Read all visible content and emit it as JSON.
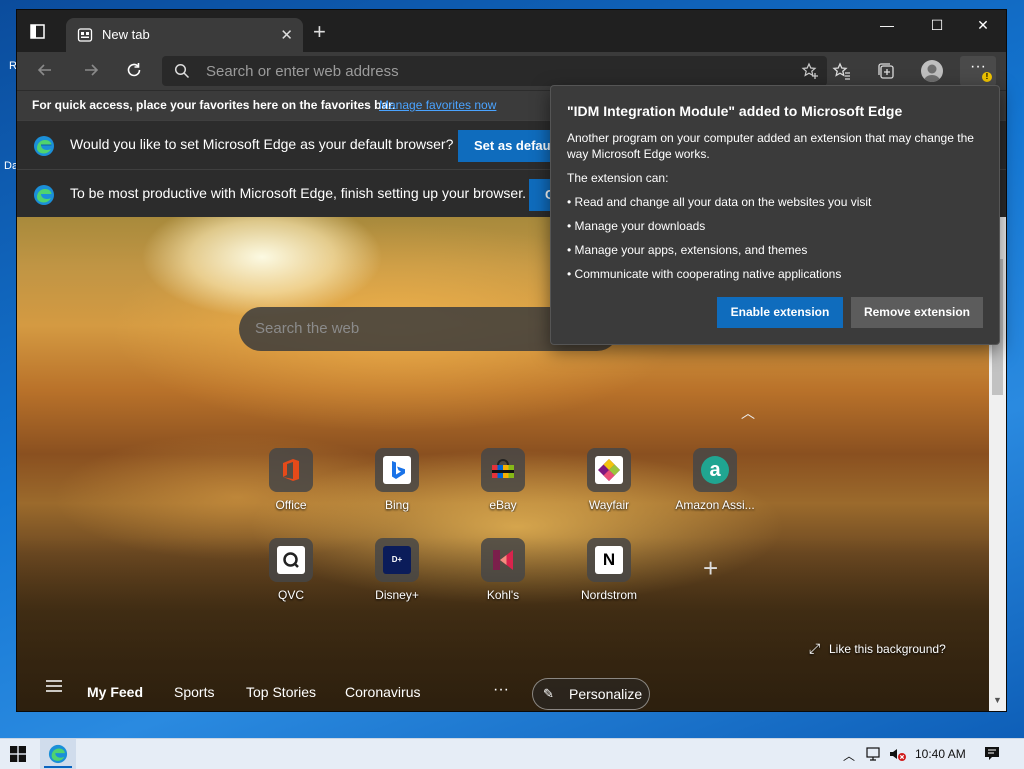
{
  "desktop": {
    "label_1": "R",
    "label_2": "Da"
  },
  "tab": {
    "title": "New tab",
    "close": "✕"
  },
  "window_controls": {
    "minimize": "—",
    "maximize": "☐",
    "close": "✕"
  },
  "new_tab": "+",
  "toolbar": {
    "address_placeholder": "Search or enter web address",
    "more": "···"
  },
  "favorites_bar": {
    "text": "For quick access, place your favorites here on the favorites bar.",
    "link": "Manage favorites now"
  },
  "infobars": [
    {
      "text": "Would you like to set Microsoft Edge as your default browser?",
      "button": "Set as default"
    },
    {
      "text": "To be most productive with Microsoft Edge, finish setting up your browser.",
      "button": "C"
    }
  ],
  "popup": {
    "title": "\"IDM Integration Module\" added to Microsoft Edge",
    "description": "Another program on your computer added an extension that may change the way Microsoft Edge works.",
    "can_label": "The extension can:",
    "permissions": [
      "• Read and change all your data on the websites you visit",
      "• Manage your downloads",
      "• Manage your apps, extensions, and themes",
      "• Communicate with cooperating native applications"
    ],
    "enable_button": "Enable extension",
    "remove_button": "Remove extension",
    "colors": {
      "primary": "#0f6cbd",
      "secondary": "#5c5c5c"
    }
  },
  "page": {
    "search_placeholder": "Search the web",
    "tiles": [
      {
        "label": "Office",
        "icon": "office-icon"
      },
      {
        "label": "Bing",
        "icon": "bing-icon"
      },
      {
        "label": "eBay",
        "icon": "ebay-icon"
      },
      {
        "label": "Wayfair",
        "icon": "wayfair-icon"
      },
      {
        "label": "Amazon Assi...",
        "icon": "amazon-icon"
      },
      {
        "label": "QVC",
        "icon": "qvc-icon"
      },
      {
        "label": "Disney+",
        "icon": "disney-icon"
      },
      {
        "label": "Kohl's",
        "icon": "kohls-icon"
      },
      {
        "label": "Nordstrom",
        "icon": "nordstrom-icon"
      }
    ],
    "like_background": "Like this background?",
    "feed": {
      "items": [
        "My Feed",
        "Sports",
        "Top Stories",
        "Coronavirus"
      ],
      "more": "···",
      "personalize": "Personalize"
    }
  },
  "taskbar": {
    "time": "10:40 AM"
  }
}
